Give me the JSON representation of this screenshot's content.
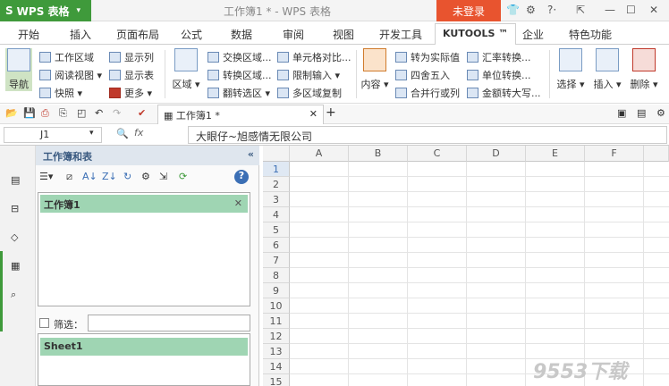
{
  "app": {
    "name": "WPS 表格",
    "logo": "S"
  },
  "window": {
    "title": "工作簿1 * - WPS 表格",
    "login": "未登录"
  },
  "tabs": [
    "开始",
    "插入",
    "页面布局",
    "公式",
    "数据",
    "审阅",
    "视图",
    "开发工具",
    "KUTOOLS ™",
    "企业",
    "特色功能"
  ],
  "ribbon": {
    "nav": "导航",
    "g1": [
      "工作区域",
      "阅读视图",
      "快照"
    ],
    "g2": [
      "显示列",
      "显示表",
      "更多"
    ],
    "area": "区域",
    "g3": [
      "交换区域...",
      "转换区域...",
      "翻转选区"
    ],
    "g4": [
      "单元格对比...",
      "限制输入",
      "多区域复制"
    ],
    "content": "内容",
    "g5": [
      "转为实际值",
      "四舍五入",
      "合并行或列"
    ],
    "g6": [
      "汇率转换...",
      "单位转换...",
      "金额转大写..."
    ],
    "select": "选择",
    "insert": "插入",
    "delete": "删除"
  },
  "doc_tab": "工作簿1 *",
  "formula_bar": {
    "cell": "J1",
    "fx": "fx",
    "content": "大眼仔~旭感情无限公司"
  },
  "panel": {
    "title": "工作簿和表",
    "workbook": "工作簿1",
    "filter_label": "筛选：",
    "sheet": "Sheet1"
  },
  "grid": {
    "columns": [
      "A",
      "B",
      "C",
      "D",
      "E",
      "F"
    ],
    "rows": [
      "1",
      "2",
      "3",
      "4",
      "5",
      "6",
      "7",
      "8",
      "9",
      "10",
      "11",
      "12",
      "13",
      "14",
      "15"
    ]
  },
  "watermark": "9553下载"
}
